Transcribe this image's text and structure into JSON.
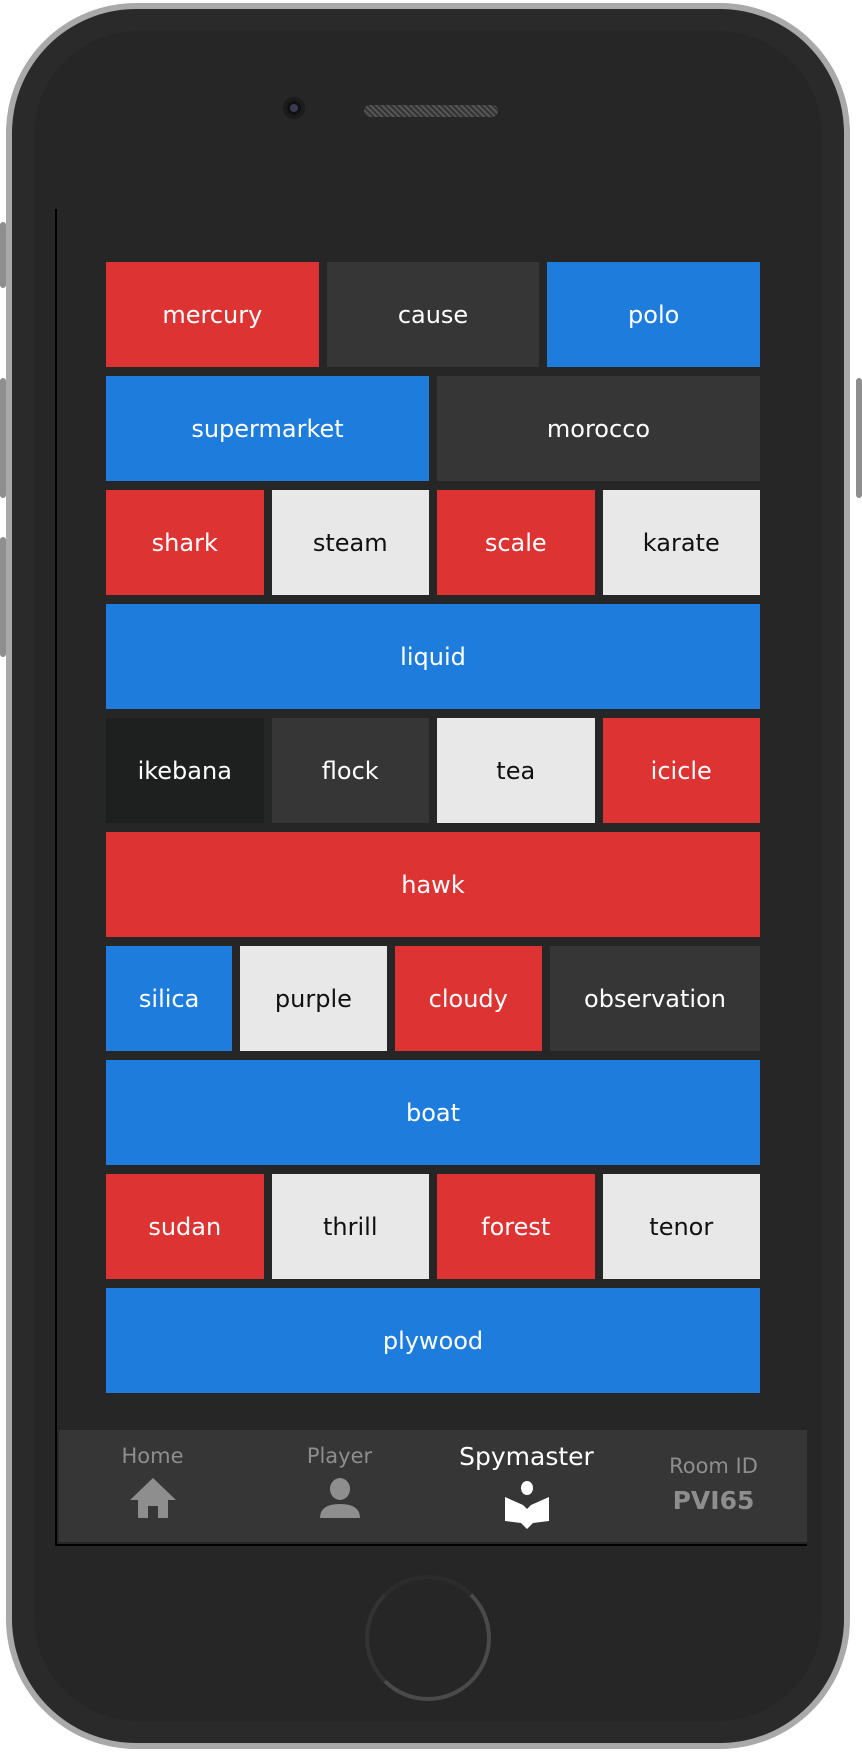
{
  "colors": {
    "red": "#dd3333",
    "blue": "#1e7ddc",
    "neutral": "#363636",
    "bystander": "#e8e8e8",
    "assassin": "#1e2020"
  },
  "board": {
    "rows": [
      [
        {
          "word": "mercury",
          "team": "red"
        },
        {
          "word": "cause",
          "team": "gray"
        },
        {
          "word": "polo",
          "team": "blue"
        }
      ],
      [
        {
          "word": "supermarket",
          "team": "blue"
        },
        {
          "word": "morocco",
          "team": "gray"
        }
      ],
      [
        {
          "word": "shark",
          "team": "red"
        },
        {
          "word": "steam",
          "team": "light"
        },
        {
          "word": "scale",
          "team": "red"
        },
        {
          "word": "karate",
          "team": "light"
        }
      ],
      [
        {
          "word": "liquid",
          "team": "blue"
        }
      ],
      [
        {
          "word": "ikebana",
          "team": "black"
        },
        {
          "word": "flock",
          "team": "gray"
        },
        {
          "word": "tea",
          "team": "light"
        },
        {
          "word": "icicle",
          "team": "red"
        }
      ],
      [
        {
          "word": "hawk",
          "team": "red"
        }
      ],
      [
        {
          "word": "silica",
          "team": "blue"
        },
        {
          "word": "purple",
          "team": "light"
        },
        {
          "word": "cloudy",
          "team": "red"
        },
        {
          "word": "observation",
          "team": "gray"
        }
      ],
      [
        {
          "word": "boat",
          "team": "blue"
        }
      ],
      [
        {
          "word": "sudan",
          "team": "red"
        },
        {
          "word": "thrill",
          "team": "light"
        },
        {
          "word": "forest",
          "team": "red"
        },
        {
          "word": "tenor",
          "team": "light"
        }
      ],
      [
        {
          "word": "plywood",
          "team": "blue"
        }
      ]
    ]
  },
  "nav": {
    "home": {
      "label": "Home",
      "icon": "home-icon"
    },
    "player": {
      "label": "Player",
      "icon": "person-icon"
    },
    "spymaster": {
      "label": "Spymaster",
      "icon": "book-reader-icon",
      "active": true
    },
    "room": {
      "label": "Room ID",
      "value": "PVI65"
    }
  }
}
